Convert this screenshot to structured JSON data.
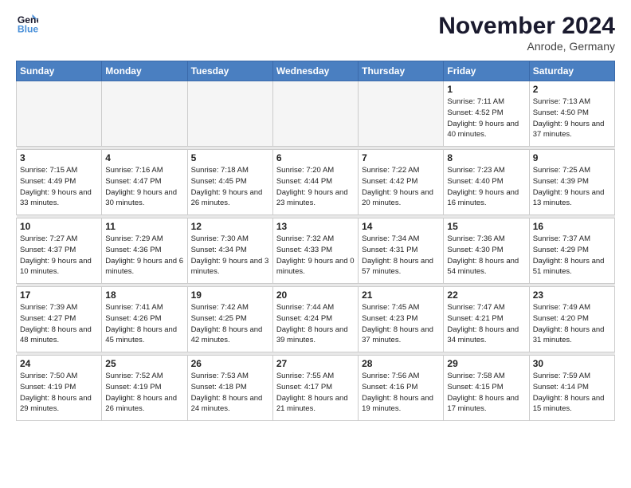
{
  "logo": {
    "line1": "General",
    "line2": "Blue"
  },
  "title": "November 2024",
  "location": "Anrode, Germany",
  "days_of_week": [
    "Sunday",
    "Monday",
    "Tuesday",
    "Wednesday",
    "Thursday",
    "Friday",
    "Saturday"
  ],
  "weeks": [
    {
      "days": [
        {
          "num": "",
          "info": ""
        },
        {
          "num": "",
          "info": ""
        },
        {
          "num": "",
          "info": ""
        },
        {
          "num": "",
          "info": ""
        },
        {
          "num": "",
          "info": ""
        },
        {
          "num": "1",
          "info": "Sunrise: 7:11 AM\nSunset: 4:52 PM\nDaylight: 9 hours\nand 40 minutes."
        },
        {
          "num": "2",
          "info": "Sunrise: 7:13 AM\nSunset: 4:50 PM\nDaylight: 9 hours\nand 37 minutes."
        }
      ]
    },
    {
      "days": [
        {
          "num": "3",
          "info": "Sunrise: 7:15 AM\nSunset: 4:49 PM\nDaylight: 9 hours\nand 33 minutes."
        },
        {
          "num": "4",
          "info": "Sunrise: 7:16 AM\nSunset: 4:47 PM\nDaylight: 9 hours\nand 30 minutes."
        },
        {
          "num": "5",
          "info": "Sunrise: 7:18 AM\nSunset: 4:45 PM\nDaylight: 9 hours\nand 26 minutes."
        },
        {
          "num": "6",
          "info": "Sunrise: 7:20 AM\nSunset: 4:44 PM\nDaylight: 9 hours\nand 23 minutes."
        },
        {
          "num": "7",
          "info": "Sunrise: 7:22 AM\nSunset: 4:42 PM\nDaylight: 9 hours\nand 20 minutes."
        },
        {
          "num": "8",
          "info": "Sunrise: 7:23 AM\nSunset: 4:40 PM\nDaylight: 9 hours\nand 16 minutes."
        },
        {
          "num": "9",
          "info": "Sunrise: 7:25 AM\nSunset: 4:39 PM\nDaylight: 9 hours\nand 13 minutes."
        }
      ]
    },
    {
      "days": [
        {
          "num": "10",
          "info": "Sunrise: 7:27 AM\nSunset: 4:37 PM\nDaylight: 9 hours\nand 10 minutes."
        },
        {
          "num": "11",
          "info": "Sunrise: 7:29 AM\nSunset: 4:36 PM\nDaylight: 9 hours\nand 6 minutes."
        },
        {
          "num": "12",
          "info": "Sunrise: 7:30 AM\nSunset: 4:34 PM\nDaylight: 9 hours\nand 3 minutes."
        },
        {
          "num": "13",
          "info": "Sunrise: 7:32 AM\nSunset: 4:33 PM\nDaylight: 9 hours\nand 0 minutes."
        },
        {
          "num": "14",
          "info": "Sunrise: 7:34 AM\nSunset: 4:31 PM\nDaylight: 8 hours\nand 57 minutes."
        },
        {
          "num": "15",
          "info": "Sunrise: 7:36 AM\nSunset: 4:30 PM\nDaylight: 8 hours\nand 54 minutes."
        },
        {
          "num": "16",
          "info": "Sunrise: 7:37 AM\nSunset: 4:29 PM\nDaylight: 8 hours\nand 51 minutes."
        }
      ]
    },
    {
      "days": [
        {
          "num": "17",
          "info": "Sunrise: 7:39 AM\nSunset: 4:27 PM\nDaylight: 8 hours\nand 48 minutes."
        },
        {
          "num": "18",
          "info": "Sunrise: 7:41 AM\nSunset: 4:26 PM\nDaylight: 8 hours\nand 45 minutes."
        },
        {
          "num": "19",
          "info": "Sunrise: 7:42 AM\nSunset: 4:25 PM\nDaylight: 8 hours\nand 42 minutes."
        },
        {
          "num": "20",
          "info": "Sunrise: 7:44 AM\nSunset: 4:24 PM\nDaylight: 8 hours\nand 39 minutes."
        },
        {
          "num": "21",
          "info": "Sunrise: 7:45 AM\nSunset: 4:23 PM\nDaylight: 8 hours\nand 37 minutes."
        },
        {
          "num": "22",
          "info": "Sunrise: 7:47 AM\nSunset: 4:21 PM\nDaylight: 8 hours\nand 34 minutes."
        },
        {
          "num": "23",
          "info": "Sunrise: 7:49 AM\nSunset: 4:20 PM\nDaylight: 8 hours\nand 31 minutes."
        }
      ]
    },
    {
      "days": [
        {
          "num": "24",
          "info": "Sunrise: 7:50 AM\nSunset: 4:19 PM\nDaylight: 8 hours\nand 29 minutes."
        },
        {
          "num": "25",
          "info": "Sunrise: 7:52 AM\nSunset: 4:19 PM\nDaylight: 8 hours\nand 26 minutes."
        },
        {
          "num": "26",
          "info": "Sunrise: 7:53 AM\nSunset: 4:18 PM\nDaylight: 8 hours\nand 24 minutes."
        },
        {
          "num": "27",
          "info": "Sunrise: 7:55 AM\nSunset: 4:17 PM\nDaylight: 8 hours\nand 21 minutes."
        },
        {
          "num": "28",
          "info": "Sunrise: 7:56 AM\nSunset: 4:16 PM\nDaylight: 8 hours\nand 19 minutes."
        },
        {
          "num": "29",
          "info": "Sunrise: 7:58 AM\nSunset: 4:15 PM\nDaylight: 8 hours\nand 17 minutes."
        },
        {
          "num": "30",
          "info": "Sunrise: 7:59 AM\nSunset: 4:14 PM\nDaylight: 8 hours\nand 15 minutes."
        }
      ]
    }
  ]
}
